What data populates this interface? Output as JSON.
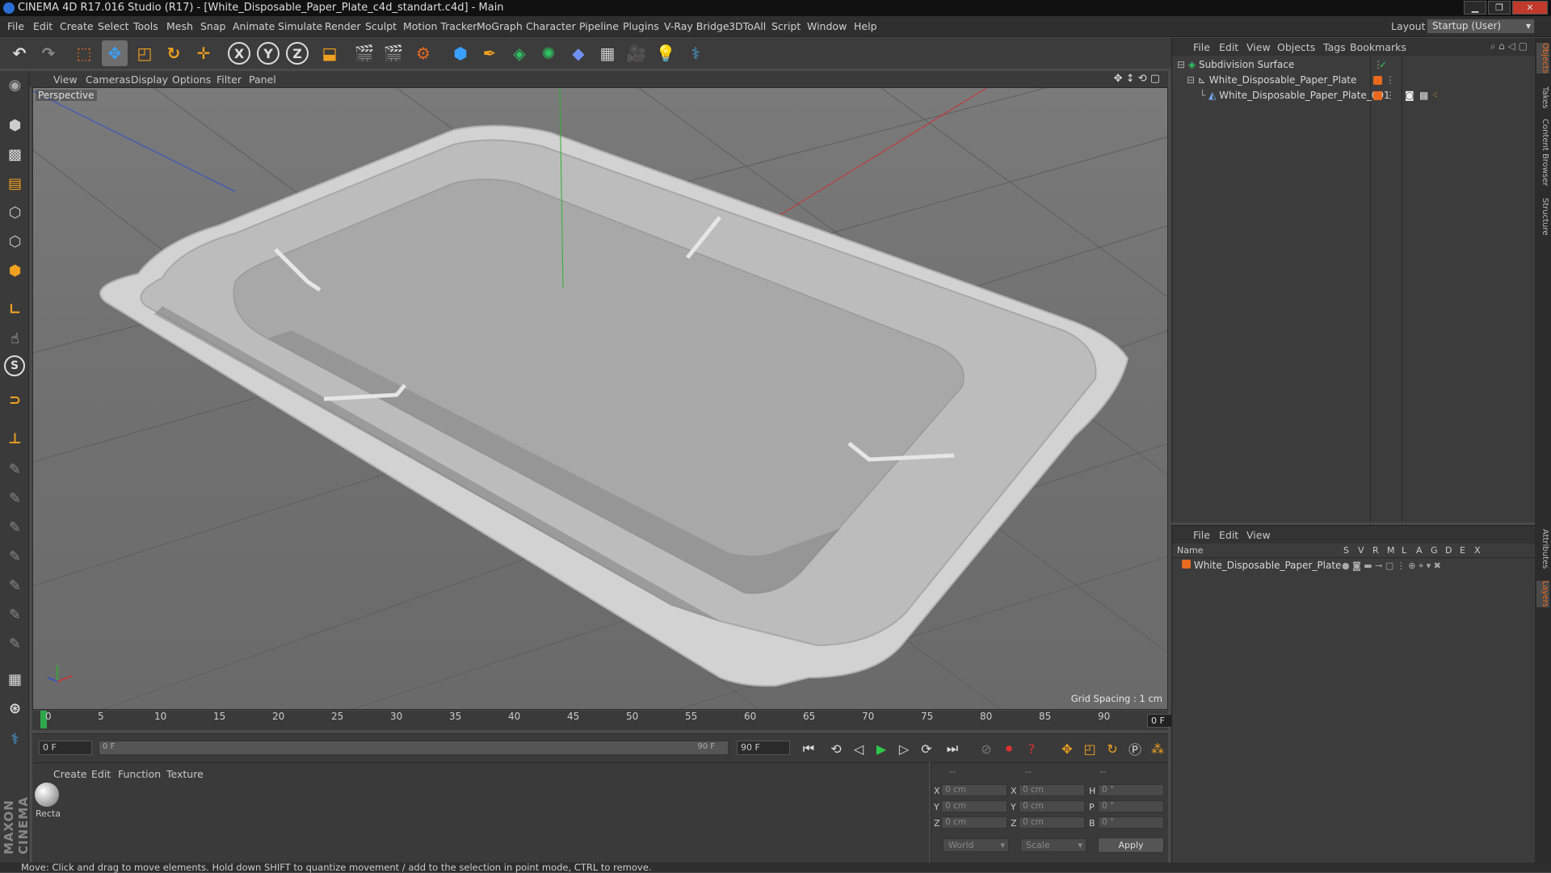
{
  "window": {
    "title": "CINEMA 4D R17.016 Studio (R17) - [White_Disposable_Paper_Plate_c4d_standart.c4d] - Main"
  },
  "menubar": {
    "items": [
      "File",
      "Edit",
      "Create",
      "Select",
      "Tools",
      "Mesh",
      "Snap",
      "Animate",
      "Simulate",
      "Render",
      "Sculpt",
      "Motion Tracker",
      "MoGraph",
      "Character",
      "Pipeline",
      "Plugins",
      "V-Ray Bridge",
      "3DToAll",
      "Script",
      "Window",
      "Help"
    ],
    "layout_label": "Layout:",
    "layout_value": "Startup (User)"
  },
  "toolbar": {
    "axis_labels": [
      "X",
      "Y",
      "Z"
    ]
  },
  "viewport": {
    "menu": [
      "View",
      "Cameras",
      "Display",
      "Options",
      "Filter",
      "Panel"
    ],
    "label": "Perspective",
    "grid_spacing": "Grid Spacing : 1 cm"
  },
  "timeline": {
    "ticks": [
      "0",
      "5",
      "10",
      "15",
      "20",
      "25",
      "30",
      "35",
      "40",
      "45",
      "50",
      "55",
      "60",
      "65",
      "70",
      "75",
      "80",
      "85",
      "90"
    ],
    "current_frame": "0 F"
  },
  "transport": {
    "start_field": "0 F",
    "range_start": "0 F",
    "range_end": "90 F",
    "end_field": "90 F"
  },
  "material_manager": {
    "menu": [
      "Create",
      "Edit",
      "Function",
      "Texture"
    ],
    "material_name": "Recta"
  },
  "coordinates": {
    "header": [
      "--",
      "--",
      "--"
    ],
    "rows": [
      {
        "l1": "X",
        "v1": "0 cm",
        "l2": "X",
        "v2": "0 cm",
        "l3": "H",
        "v3": "0 °"
      },
      {
        "l1": "Y",
        "v1": "0 cm",
        "l2": "Y",
        "v2": "0 cm",
        "l3": "P",
        "v3": "0 °"
      },
      {
        "l1": "Z",
        "v1": "0 cm",
        "l2": "Z",
        "v2": "0 cm",
        "l3": "B",
        "v3": "0 °"
      }
    ],
    "space_select": "World",
    "mode_select": "Scale",
    "apply_label": "Apply"
  },
  "object_manager": {
    "menu": [
      "File",
      "Edit",
      "View",
      "Objects",
      "Tags",
      "Bookmarks"
    ],
    "objects": [
      {
        "name": "Subdivision Surface",
        "depth": 0
      },
      {
        "name": "White_Disposable_Paper_Plate",
        "depth": 1
      },
      {
        "name": "White_Disposable_Paper_Plate_001",
        "depth": 2
      }
    ]
  },
  "layer_manager": {
    "menu": [
      "File",
      "Edit",
      "View"
    ],
    "columns": [
      "Name",
      "S",
      "V",
      "R",
      "M",
      "L",
      "A",
      "G",
      "D",
      "E",
      "X"
    ],
    "layers": [
      {
        "name": "White_Disposable_Paper_Plate",
        "color": "#e86a1e"
      }
    ]
  },
  "side_tabs": [
    "Objects",
    "Takes",
    "Content Browser",
    "Structure",
    "Attributes",
    "Layers"
  ],
  "brand": {
    "text": "MAXON CINEMA 4D"
  },
  "status": {
    "text": "Move: Click and drag to move elements. Hold down SHIFT to quantize movement / add to the selection in point mode, CTRL to remove."
  },
  "colors": {
    "accent": "#e86a1e",
    "axis_x": "#d03030",
    "axis_y": "#30b030",
    "axis_z": "#3050d0"
  }
}
